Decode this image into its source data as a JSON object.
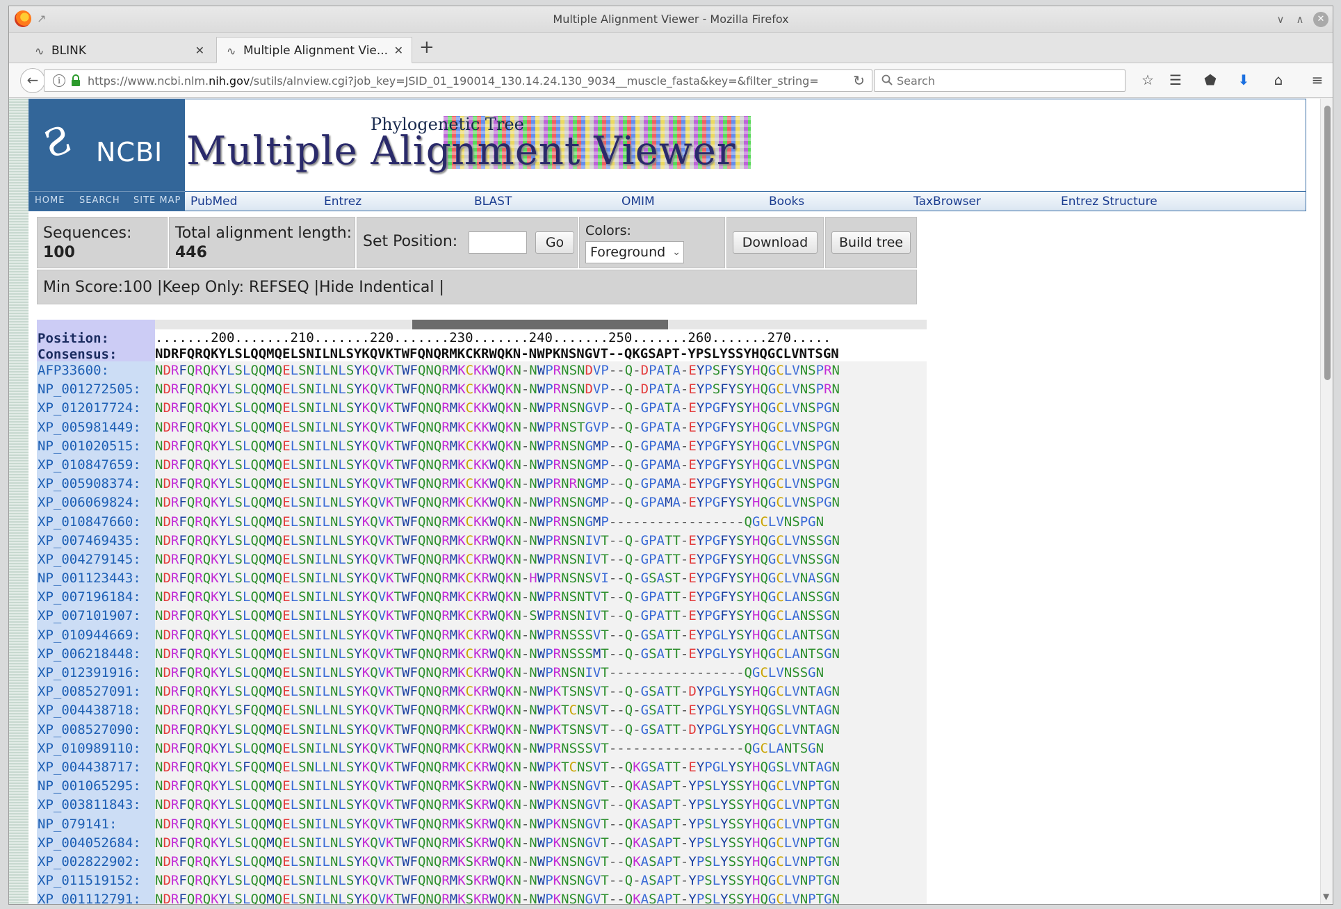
{
  "window": {
    "title": "Multiple Alignment Viewer - Mozilla Firefox",
    "tabs": [
      {
        "label": "BLINK",
        "active": false
      },
      {
        "label": "Multiple Alignment Vie...",
        "active": true
      }
    ]
  },
  "navbar": {
    "url_prefix": "https://www.ncbi.nlm.",
    "url_domain": "nih.gov",
    "url_suffix": "/sutils/alnview.cgi?job_key=JSID_01_190014_130.14.24.130_9034__muscle_fasta&key=&filter_string=M",
    "search_placeholder": "Search"
  },
  "header": {
    "logo_text": "NCBI",
    "sublinks": [
      "HOME",
      "SEARCH",
      "SITE MAP"
    ],
    "banner_sub": "Phylogenetic Tree",
    "banner_main": "Multiple Alignment Viewer",
    "nav_links": [
      "PubMed",
      "Entrez",
      "BLAST",
      "OMIM",
      "Books",
      "TaxBrowser",
      "Entrez Structure"
    ]
  },
  "controls": {
    "sequences_label": "Sequences:",
    "sequences_value": "100",
    "length_label": "Total alignment length:",
    "length_value": "446",
    "set_position_label": "Set Position:",
    "go_label": "Go",
    "colors_label": "Colors:",
    "colors_value": "Foreground",
    "download_label": "Download",
    "build_tree_label": "Build tree",
    "filter_text": "Min Score:100 |Keep Only: REFSEQ |Hide Indentical |"
  },
  "alignment": {
    "position_label": "Position:",
    "consensus_label": "Consensus:",
    "ruler": ".......200.......210.......220.......230.......240.......250.......260.......270.....",
    "consensus": "NDRFQRQKYLSLQQMQELSNILNLSYKQVKTWFQNQRMKCKRWQKN-NWPKNSNGVT--QKGSAPT-YPSLYSSYHQGCLVNTSGN",
    "rows": [
      {
        "acc": "AFP33600:",
        "seq": "NDRFQRQKYLSLQQMQELSNILNLSYKQVKTWFQNQRMKCKKWQKN-NWPRNSNDVP--Q-DPATA-EYPSFYSYHQGCLVNSPRN"
      },
      {
        "acc": "NP_001272505:",
        "seq": "NDRFQRQKYLSLQQMQELSNILNLSYKQVKTWFQNQRMKCKKWQKN-NWPRNSNDVP--Q-DPATA-EYPSFYSYHQGCLVNSPRN"
      },
      {
        "acc": "XP_012017724:",
        "seq": "NDRFQRQKYLSLQQMQELSNILNLSYKQVKTWFQNQRMKCKKWQKN-NWPRNSNGVP--Q-GPATA-EYPGFYSYHQGCLVNSPGN"
      },
      {
        "acc": "XP_005981449:",
        "seq": "NDRFQRQKYLSLQQMQELSNILNLSYKQVKTWFQNQRMKCKKWQKN-NWPRNSTGVP--Q-GPATA-EYPGFYSYHQGCLVNSPGN"
      },
      {
        "acc": "NP_001020515:",
        "seq": "NDRFQRQKYLSLQQMQELSNILNLSYKQVKTWFQNQRMKCKKWQKN-NWPRNSNGMP--Q-GPAMA-EYPGFYSYHQGCLVNSPGN"
      },
      {
        "acc": "XP_010847659:",
        "seq": "NDRFQRQKYLSLQQMQELSNILNLSYKQVKTWFQNQRMKCKKWQKN-NWPRNSNGMP--Q-GPAMA-EYPGFYSYHQGCLVNSPGN"
      },
      {
        "acc": "XP_005908374:",
        "seq": "NDRFQRQKYLSLQQMQELSNILNLSYKQVKTWFQNQRMKCKKWQKN-NWPRNRNGMP--Q-GPAMA-EYPGFYSYHQGCLVNSPGN"
      },
      {
        "acc": "XP_006069824:",
        "seq": "NDRFQRQKYLSLQQMQELSNILNLSYKQVKTWFQNQRMKCKKWQKN-NWPRNSNGMP--Q-GPAMA-EYPGFYSYHQGCLVNSPGN"
      },
      {
        "acc": "XP_010847660:",
        "seq": "NDRFQRQKYLSLQQMQELSNILNLSYKQVKTWFQNQRMKCKKWQKN-NWPRNSNGMP-----------------QGCLVNSPGN"
      },
      {
        "acc": "XP_007469435:",
        "seq": "NDRFQRQKYLSLQQMQELSNILNLSYKQVKTWFQNQRMKCKRWQKN-NWPRNSNIVT--Q-GPATT-EYPGFYSYHQGCLVNSSGN"
      },
      {
        "acc": "XP_004279145:",
        "seq": "NDRFQRQKYLSLQQMQELSNILNLSYKQVKTWFQNQRMKCKRWQKN-NWPRNSNIVT--Q-GPATT-EYPGFYSYHQGCLVNSSGN"
      },
      {
        "acc": "NP_001123443:",
        "seq": "NDRFQRQKYLSLQQMQELSNILNLSYKQVKTWFQNQRMKCKRWQKN-HWPRNSNSVI--Q-GSAST-EYPGFYSYHQGCLVNASGN"
      },
      {
        "acc": "XP_007196184:",
        "seq": "NDRFQRQKYLSLQQMQELSNILNLSYKQVKTWFQNQRMKCKRWQKN-NWPRNSNTVT--Q-GPATT-EYPGFYSYHQGCLANSSGN"
      },
      {
        "acc": "XP_007101907:",
        "seq": "NDRFQRQKYLSLQQMQELSNILNLSYKQVKTWFQNQRMKCKRWQKN-SWPRNSNIVT--Q-GPATT-EYPGFYSYHQGCLANSSGN"
      },
      {
        "acc": "XP_010944669:",
        "seq": "NDRFQRQKYLSLQQMQELSNILNLSYKQVKTWFQNQRMKCKRWQKN-NWPRNSSSVT--Q-GSATT-EYPGLYSYHQGCLANTSGN"
      },
      {
        "acc": "XP_006218448:",
        "seq": "NDRFQRQKYLSLQQMQELSNILNLSYKQVKTWFQNQRMKCKRWQKN-NWPRNSSSMT--Q-GSATT-EYPGLYSYHQGCLANTSGN"
      },
      {
        "acc": "XP_012391916:",
        "seq": "NDRFQRQKYLSLQQMQELSNILNLSYKQVKTWFQNQRMKCKRWQKN-NWPRNSNIVT-----------------QGCLVNSSGN"
      },
      {
        "acc": "XP_008527091:",
        "seq": "NDRFQRQKYLSLQQMQELSNILNLSYKQVKTWFQNQRMKCKRWQKN-NWPKTSNSVT--Q-GSATT-DYPGLYSYHQGCLVNTAGN"
      },
      {
        "acc": "XP_004438718:",
        "seq": "NDRFQRQKYLSFQQMQELSNLLNLSYKQVKTWFQNQRMKCKRWQKN-NWPKTCNSVT--Q-GSATT-EYPGLYSYHQGSLVNTAGN"
      },
      {
        "acc": "XP_008527090:",
        "seq": "NDRFQRQKYLSLQQMQELSNILNLSYKQVKTWFQNQRMKCKRWQKN-NWPKTSNSVT--Q-GSATT-DYPGLYSYHQGCLVNTAGN"
      },
      {
        "acc": "XP_010989110:",
        "seq": "NDRFQRQKYLSLQQMQELSNILNLSYKQVKTWFQNQRMKCKRWQKN-NWPRNSSSVT-----------------QGCLANTSGN"
      },
      {
        "acc": "XP_004438717:",
        "seq": "NDRFQRQKYLSFQQMQELSNLLNLSYKQVKTWFQNQRMKCKRWQKN-NWPKTCNSVT--QKGSATT-EYPGLYSYHQGSLVNTAGN"
      },
      {
        "acc": "NP_001065295:",
        "seq": "NDRFQRQKYLSLQQMQELSNILNLSYKQVKTWFQNQRMKSKRWQKN-NWPKNSNGVT--QKASAPT-YPSLYSSYHQGCLVNPTGN"
      },
      {
        "acc": "XP_003811843:",
        "seq": "NDRFQRQKYLSLQQMQELSNILNLSYKQVKTWFQNQRMKSKRWQKN-NWPKNSNGVT--QKASAPT-YPSLYSSYHQGCLVNPTGN"
      },
      {
        "acc": "NP_079141:",
        "seq": "NDRFQRQKYLSLQQMQELSNILNLSYKQVKTWFQNQRMKSKRWQKN-NWPKNSNGVT--QKASAPT-YPSLYSSYHQGCLVNPTGN"
      },
      {
        "acc": "XP_004052684:",
        "seq": "NDRFQRQKYLSLQQMQELSNILNLSYKQVKTWFQNQRMKSKRWQKN-NWPKNSNGVT--QKASAPT-YPSLYSSYHQGCLVNPTGN"
      },
      {
        "acc": "XP_002822902:",
        "seq": "NDRFQRQKYLSLQQMQELSNILNLSYKQVKTWFQNQRMKSKRWQKN-NWPKNSNGVT--QKASAPT-YPSLYSSYHQGCLVNPTGN"
      },
      {
        "acc": "XP_011519152:",
        "seq": "NDRFQRQKYLSLQQMQELSNILNLSYKQVKTWFQNQRMKSKRWQKN-NWPKNSNGVT--Q-ASAPT-YPSLYSSYHQGCLVNPTGN"
      },
      {
        "acc": "XP_001112791:",
        "seq": "NDRFQRQKYLSLQQMQELSNILNLSYKQVKTWFQNQRMKSKRWQKN-NWPKNSNGVT--QKASAPT-YPSLYSSYHQGCLVNPTGN"
      }
    ]
  }
}
